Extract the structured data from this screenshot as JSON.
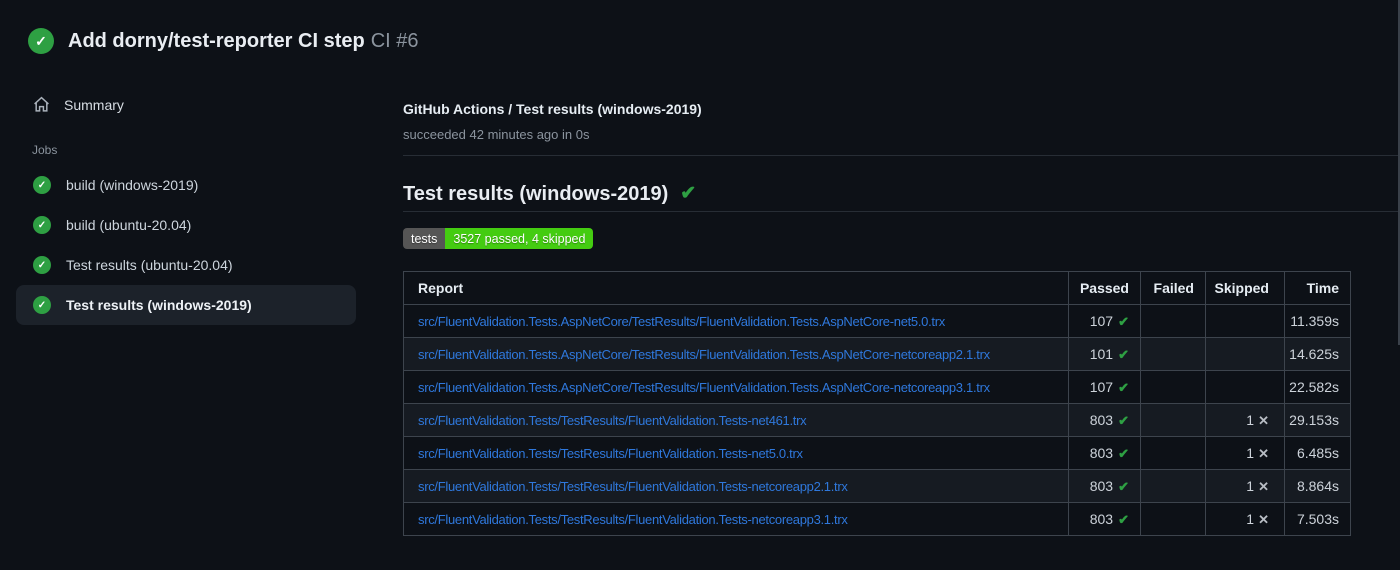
{
  "header": {
    "title": "Add dorny/test-reporter CI step",
    "run_number": "CI #6"
  },
  "sidebar": {
    "summary_label": "Summary",
    "jobs_label": "Jobs",
    "jobs": [
      {
        "label": "build (windows-2019)",
        "status": "success",
        "selected": false
      },
      {
        "label": "build (ubuntu-20.04)",
        "status": "success",
        "selected": false
      },
      {
        "label": "Test results (ubuntu-20.04)",
        "status": "success",
        "selected": false
      },
      {
        "label": "Test results (windows-2019)",
        "status": "success",
        "selected": true
      }
    ]
  },
  "main": {
    "breadcrumb": "GitHub Actions / Test results (windows-2019)",
    "status_line": "succeeded 42 minutes ago in 0s",
    "heading": "Test results (windows-2019)",
    "badge": {
      "label": "tests",
      "value": "3527 passed, 4 skipped",
      "label_bg": "#555555",
      "value_bg": "#44cc11"
    },
    "table": {
      "columns": [
        "Report",
        "Passed",
        "Failed",
        "Skipped",
        "Time"
      ],
      "rows": [
        {
          "report": "src/FluentValidation.Tests.AspNetCore/TestResults/FluentValidation.Tests.AspNetCore-net5.0.trx",
          "passed": "107",
          "failed": "",
          "skipped": "",
          "time": "11.359s"
        },
        {
          "report": "src/FluentValidation.Tests.AspNetCore/TestResults/FluentValidation.Tests.AspNetCore-netcoreapp2.1.trx",
          "passed": "101",
          "failed": "",
          "skipped": "",
          "time": "14.625s"
        },
        {
          "report": "src/FluentValidation.Tests.AspNetCore/TestResults/FluentValidation.Tests.AspNetCore-netcoreapp3.1.trx",
          "passed": "107",
          "failed": "",
          "skipped": "",
          "time": "22.582s"
        },
        {
          "report": "src/FluentValidation.Tests/TestResults/FluentValidation.Tests-net461.trx",
          "passed": "803",
          "failed": "",
          "skipped": "1",
          "time": "29.153s"
        },
        {
          "report": "src/FluentValidation.Tests/TestResults/FluentValidation.Tests-net5.0.trx",
          "passed": "803",
          "failed": "",
          "skipped": "1",
          "time": "6.485s"
        },
        {
          "report": "src/FluentValidation.Tests/TestResults/FluentValidation.Tests-netcoreapp2.1.trx",
          "passed": "803",
          "failed": "",
          "skipped": "1",
          "time": "8.864s"
        },
        {
          "report": "src/FluentValidation.Tests/TestResults/FluentValidation.Tests-netcoreapp3.1.trx",
          "passed": "803",
          "failed": "",
          "skipped": "1",
          "time": "7.503s"
        }
      ]
    }
  },
  "icons": {
    "circle_check_glyph": "✓",
    "check_glyph": "✔",
    "cross_glyph": "✕"
  },
  "colors": {
    "background": "#0d1117",
    "row_alt": "#161b22",
    "table_border": "#3d444d",
    "success_green": "#2ea043",
    "link_blue": "#2f78dc",
    "muted_text": "#8b949e"
  }
}
